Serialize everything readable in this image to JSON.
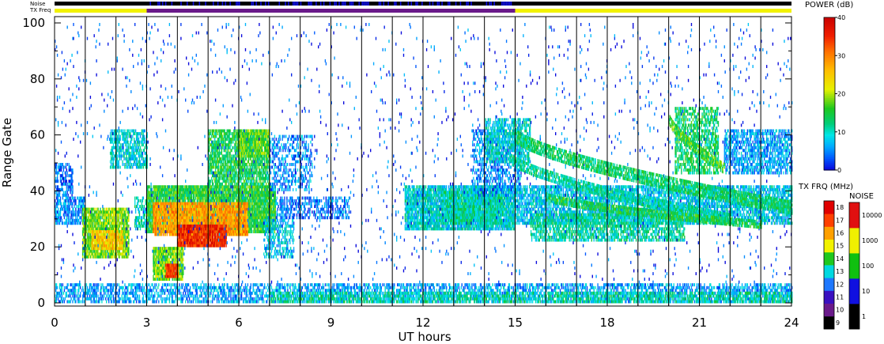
{
  "chart_data": {
    "type": "heatmap",
    "title": "",
    "xlabel": "UT hours",
    "ylabel": "Range Gate",
    "x_range": [
      0,
      24
    ],
    "y_range": [
      0,
      100
    ],
    "x_ticks": [
      "0",
      "3",
      "6",
      "9",
      "12",
      "15",
      "18",
      "21",
      "24"
    ],
    "y_ticks": [
      "0",
      "20",
      "40",
      "60",
      "80",
      "100"
    ],
    "grid_vertical_every_hours": 1,
    "top_bars": {
      "noise_label": "Noise",
      "txfreq_label": "TX Freq",
      "txfreq_segments": [
        {
          "start": 0,
          "end": 3,
          "freq_mhz": 15
        },
        {
          "start": 3,
          "end": 15,
          "freq_mhz": 10
        },
        {
          "start": 15,
          "end": 24,
          "freq_mhz": 15
        }
      ],
      "noise_level": 10
    },
    "power_colorbar": {
      "title": "POWER (dB)",
      "min": 0,
      "max": 40,
      "ticks": [
        "0",
        "10",
        "20",
        "30",
        "40"
      ]
    },
    "txfreq_colorbar": {
      "title": "TX FRQ (MHz)",
      "ticks": [
        "9",
        "10",
        "11",
        "12",
        "13",
        "14",
        "15",
        "16",
        "17",
        "18"
      ],
      "colors": [
        "#000000",
        "#6a1a8a",
        "#3a10c0",
        "#1e78ff",
        "#00d8e0",
        "#1ec81e",
        "#f2f200",
        "#ffa000",
        "#ff4000",
        "#e00000"
      ]
    },
    "noise_colorbar": {
      "title": "NOISE",
      "ticks": [
        "1",
        "10",
        "100",
        "1000",
        "10000"
      ],
      "colors": [
        "#000000",
        "#1010e0",
        "#10c010",
        "#f0f000",
        "#e01010"
      ]
    },
    "regions": [
      {
        "t0": 0.0,
        "t1": 0.6,
        "g0": 38,
        "g1": 50,
        "power": 4,
        "density": 0.55
      },
      {
        "t0": 0.0,
        "t1": 1.0,
        "g0": 28,
        "g1": 38,
        "power": 5,
        "density": 0.6
      },
      {
        "t0": 0.9,
        "t1": 2.4,
        "g0": 16,
        "g1": 34,
        "power": 18,
        "density": 0.85
      },
      {
        "t0": 1.2,
        "t1": 2.2,
        "g0": 19,
        "g1": 26,
        "power": 25,
        "density": 0.8
      },
      {
        "t0": 1.8,
        "t1": 3.0,
        "g0": 48,
        "g1": 62,
        "power": 9,
        "density": 0.6
      },
      {
        "t0": 2.6,
        "t1": 3.0,
        "g0": 26,
        "g1": 38,
        "power": 10,
        "density": 0.5
      },
      {
        "t0": 3.0,
        "t1": 7.2,
        "g0": 25,
        "g1": 42,
        "power": 15,
        "density": 0.9
      },
      {
        "t0": 3.2,
        "t1": 6.3,
        "g0": 24,
        "g1": 36,
        "power": 28,
        "density": 0.9
      },
      {
        "t0": 4.0,
        "t1": 5.6,
        "g0": 20,
        "g1": 28,
        "power": 35,
        "density": 0.95
      },
      {
        "t0": 3.2,
        "t1": 4.2,
        "g0": 8,
        "g1": 20,
        "power": 18,
        "density": 0.85
      },
      {
        "t0": 3.6,
        "t1": 4.0,
        "g0": 9,
        "g1": 14,
        "power": 34,
        "density": 0.95
      },
      {
        "t0": 5.0,
        "t1": 7.0,
        "g0": 42,
        "g1": 62,
        "power": 14,
        "density": 0.7
      },
      {
        "t0": 6.0,
        "t1": 7.0,
        "g0": 52,
        "g1": 62,
        "power": 17,
        "density": 0.7
      },
      {
        "t0": 7.0,
        "t1": 8.4,
        "g0": 40,
        "g1": 60,
        "power": 5,
        "density": 0.35
      },
      {
        "t0": 7.2,
        "t1": 9.6,
        "g0": 30,
        "g1": 38,
        "power": 4,
        "density": 0.4
      },
      {
        "t0": 6.8,
        "t1": 7.8,
        "g0": 16,
        "g1": 30,
        "power": 8,
        "density": 0.45
      },
      {
        "t0": 11.4,
        "t1": 15.0,
        "g0": 26,
        "g1": 42,
        "power": 9,
        "density": 0.85
      },
      {
        "t0": 12.6,
        "t1": 14.6,
        "g0": 28,
        "g1": 40,
        "power": 11,
        "density": 0.8
      },
      {
        "t0": 13.6,
        "t1": 15.2,
        "g0": 38,
        "g1": 62,
        "power": 5,
        "density": 0.45
      },
      {
        "t0": 14.0,
        "t1": 15.5,
        "g0": 50,
        "g1": 66,
        "power": 9,
        "density": 0.55
      },
      {
        "t0": 15.0,
        "t1": 24.0,
        "g0": 28,
        "g1": 42,
        "power": 8,
        "density": 0.65
      },
      {
        "t0": 15.5,
        "t1": 20.5,
        "g0": 22,
        "g1": 32,
        "power": 11,
        "density": 0.6
      },
      {
        "t0": 20.2,
        "t1": 21.6,
        "g0": 46,
        "g1": 70,
        "power": 13,
        "density": 0.55
      },
      {
        "t0": 21.8,
        "t1": 24.0,
        "g0": 46,
        "g1": 62,
        "power": 6,
        "density": 0.55
      },
      {
        "t0": 0.0,
        "t1": 24.0,
        "g0": 0,
        "g1": 7,
        "power": 6,
        "density": 0.5
      },
      {
        "t0": 7.0,
        "t1": 24.0,
        "g0": 0,
        "g1": 4,
        "power": 11,
        "density": 0.55
      },
      {
        "t0": 0.0,
        "t1": 24.0,
        "g0": 7,
        "g1": 100,
        "power": 3,
        "density": 0.02
      }
    ],
    "arcs": [
      {
        "t0": 15.0,
        "t1": 24.0,
        "g_start": 60,
        "g_end": 34,
        "width": 5,
        "power": 13
      },
      {
        "t0": 14.8,
        "t1": 22.0,
        "g_start": 52,
        "g_end": 30,
        "width": 4,
        "power": 11
      },
      {
        "t0": 16.0,
        "t1": 23.0,
        "g_start": 38,
        "g_end": 28,
        "width": 3,
        "power": 14
      },
      {
        "t0": 20.0,
        "t1": 21.8,
        "g_start": 66,
        "g_end": 48,
        "width": 4,
        "power": 16
      }
    ]
  }
}
